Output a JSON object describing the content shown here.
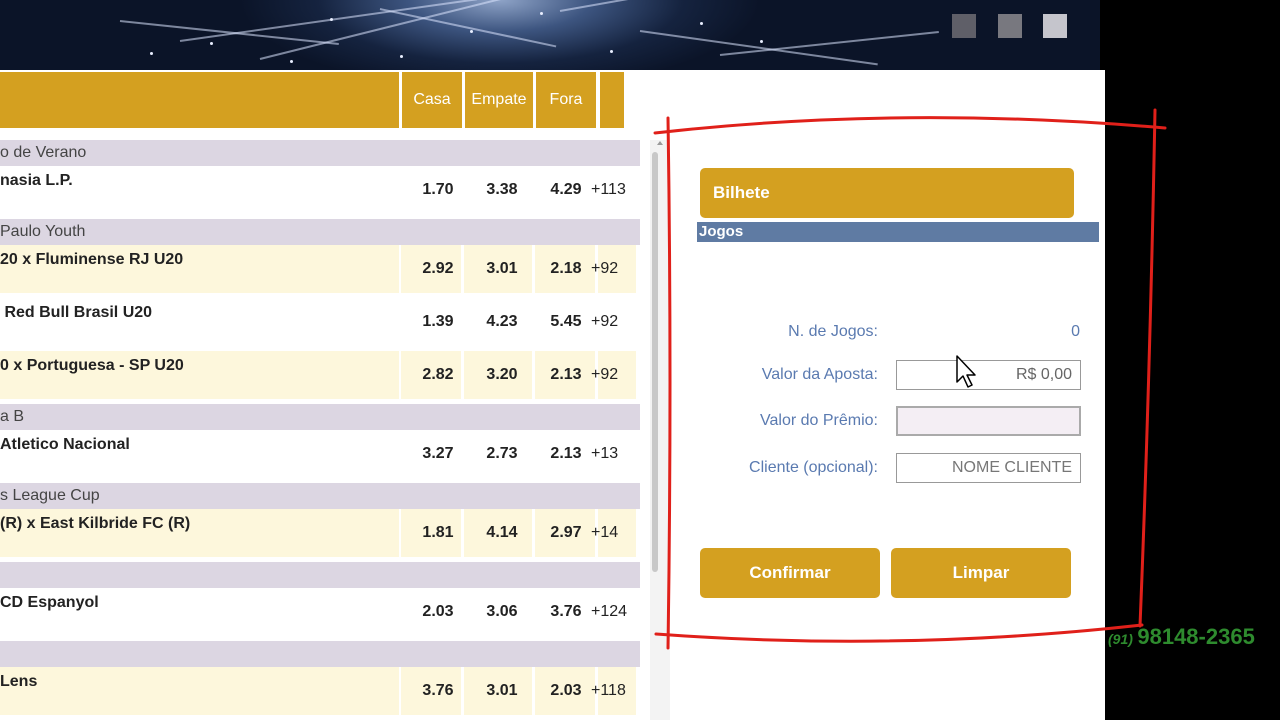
{
  "table": {
    "headers": [
      "Casa",
      "Empate",
      "Fora"
    ],
    "leagues": [
      {
        "name": "o de Verano",
        "matches": [
          {
            "name": "nasia L.P.",
            "odds": [
              "1.70",
              "3.38",
              "4.29"
            ],
            "more": "+113",
            "highlight": false
          }
        ]
      },
      {
        "name": "Paulo Youth",
        "matches": [
          {
            "name": "20 x Fluminense RJ U20",
            "odds": [
              "2.92",
              "3.01",
              "2.18"
            ],
            "more": "+92",
            "highlight": true
          },
          {
            "name": " Red Bull Brasil U20",
            "odds": [
              "1.39",
              "4.23",
              "5.45"
            ],
            "more": "+92",
            "highlight": false
          },
          {
            "name": "0 x Portuguesa - SP U20",
            "odds": [
              "2.82",
              "3.20",
              "2.13"
            ],
            "more": "+92",
            "highlight": true
          }
        ]
      },
      {
        "name": "a B",
        "matches": [
          {
            "name": "Atletico Nacional",
            "odds": [
              "3.27",
              "2.73",
              "2.13"
            ],
            "more": "+13",
            "highlight": false
          }
        ]
      },
      {
        "name": "s League Cup",
        "matches": [
          {
            "name": "(R) x East Kilbride FC (R)",
            "odds": [
              "1.81",
              "4.14",
              "2.97"
            ],
            "more": "+14",
            "highlight": true
          }
        ]
      },
      {
        "name": "",
        "matches": [
          {
            "name": "CD Espanyol",
            "odds": [
              "2.03",
              "3.06",
              "3.76"
            ],
            "more": "+124",
            "highlight": false
          }
        ]
      },
      {
        "name": "",
        "matches": [
          {
            "name": "Lens",
            "odds": [
              "3.76",
              "3.01",
              "2.03"
            ],
            "more": "+118",
            "highlight": true
          }
        ]
      }
    ]
  },
  "slip": {
    "title": "Bilhete",
    "games_bar": "Jogos",
    "games_label": "N. de Jogos:",
    "games_count": "0",
    "bet_label": "Valor da Aposta:",
    "bet_value": "R$ 0,00",
    "prize_label": "Valor do Prêmio:",
    "prize_value": "",
    "client_label": "Cliente (opcional):",
    "client_placeholder": "NOME CLIENTE",
    "confirm_label": "Confirmar",
    "clear_label": "Limpar"
  },
  "overlay": {
    "phone_ddd": "(91)",
    "phone_number": "98148-2365"
  },
  "colors": {
    "accent": "#d4a020",
    "league_band": "#dcd6e2",
    "highlight_row": "#fdf7dc",
    "games_bar": "#5f7ba3",
    "annotation": "#e0201a",
    "phone": "#2e8b2e"
  }
}
